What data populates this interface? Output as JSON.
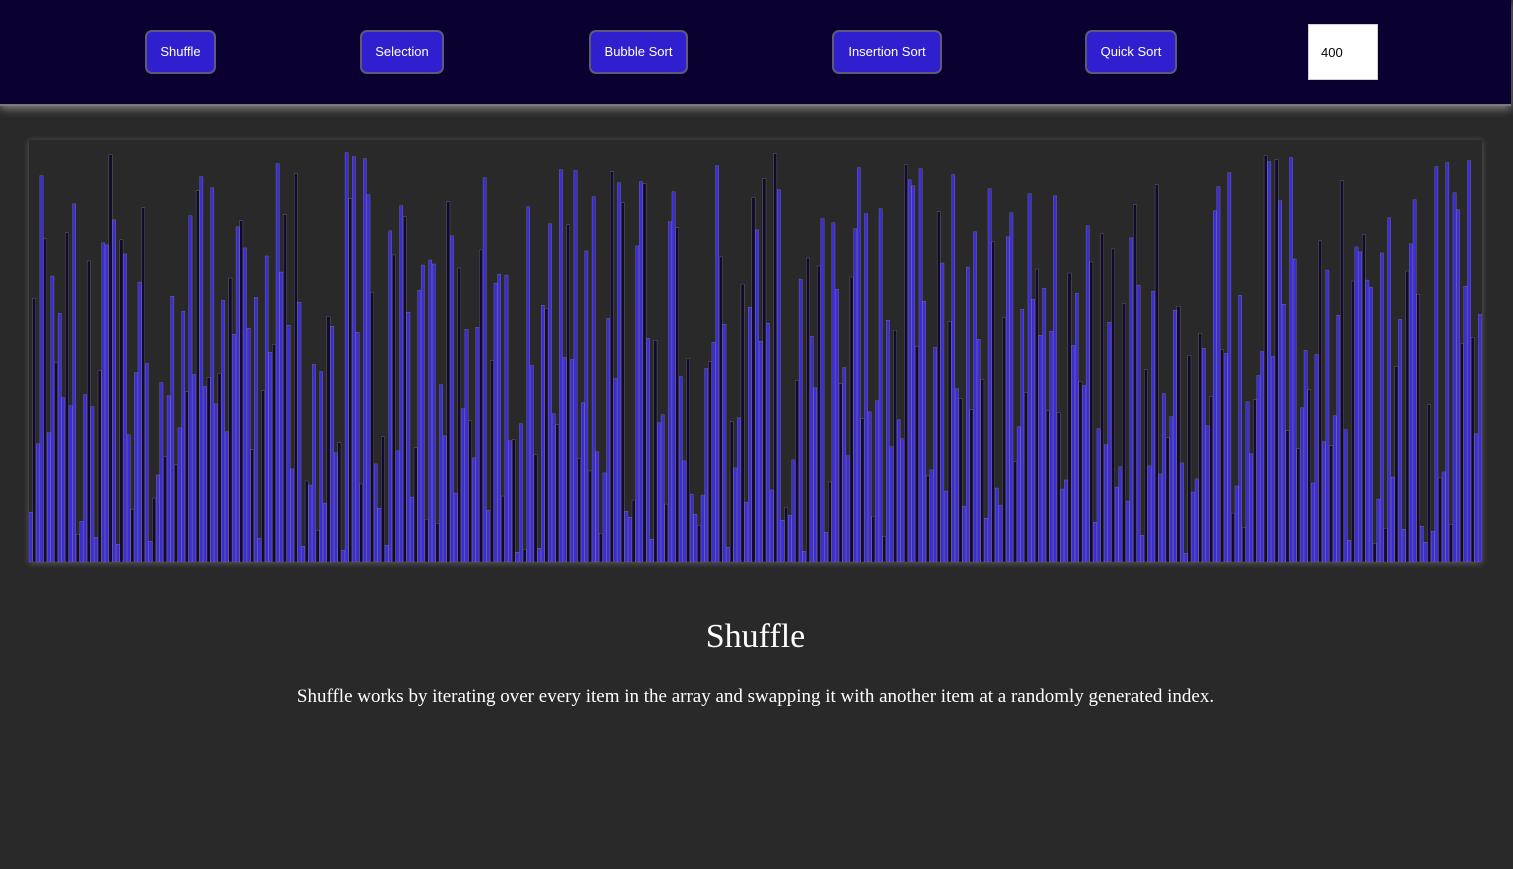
{
  "toolbar": {
    "shuffle_label": "Shuffle",
    "selection_label": "Selection",
    "bubble_label": "Bubble Sort",
    "insertion_label": "Insertion Sort",
    "quick_label": "Quick Sort",
    "array_size_value": "400"
  },
  "info": {
    "title": "Shuffle",
    "description": "Shuffle works by iterating over every item in the array and swapping it with another item at a randomly generated index."
  },
  "colors": {
    "header_bg": "#0b0130",
    "button_bg": "#2f1fcf",
    "bar_fill": "#3c2bd8",
    "bar_dark": "#120a2e",
    "page_bg": "#292929"
  },
  "chart_data": {
    "type": "bar",
    "series_count": 400,
    "seed": 7,
    "min_value": 0.02,
    "max_value": 1.0
  }
}
